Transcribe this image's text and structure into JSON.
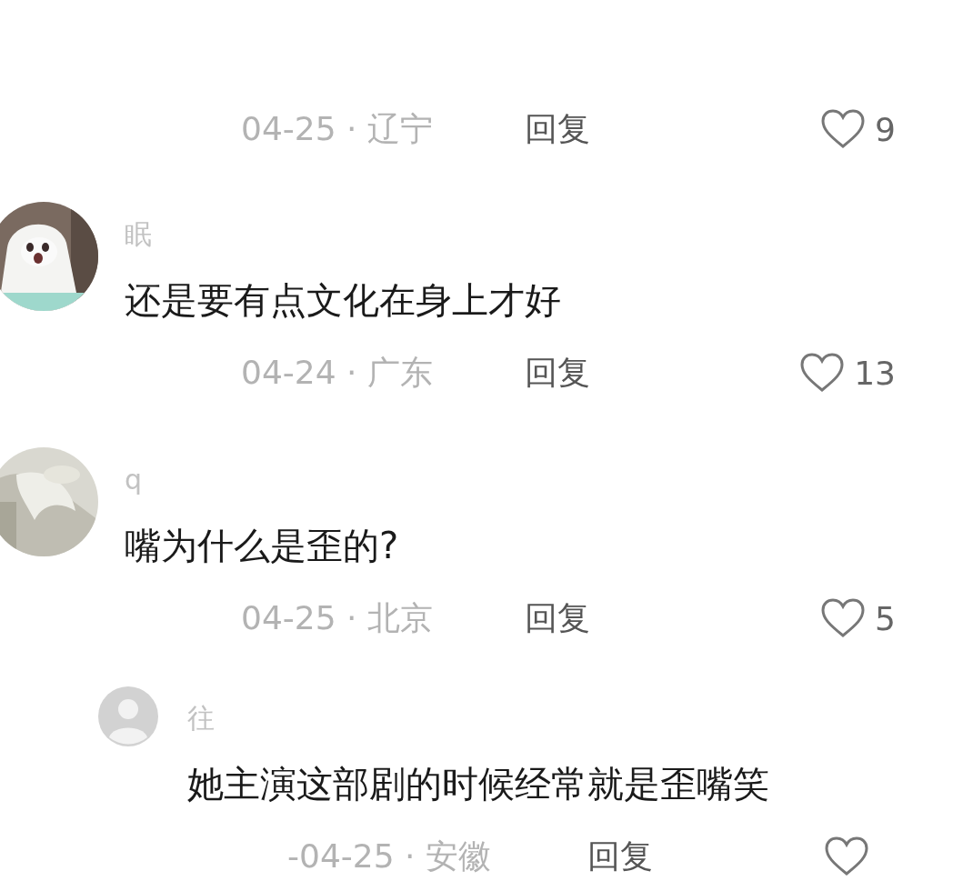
{
  "comments": [
    {
      "meta": "04-25 · 辽宁",
      "reply": "回复",
      "likes": "9"
    },
    {
      "name": "眠",
      "text": "还是要有点文化在身上才好",
      "meta": "04-24 · 广东",
      "reply": "回复",
      "likes": "13"
    },
    {
      "name": "q",
      "text": "嘴为什么是歪的?",
      "meta": "04-25 · 北京",
      "reply": "回复",
      "likes": "5",
      "children": [
        {
          "avatar": {
            "kind": "default"
          },
          "name": "往",
          "text": "她主演这部剧的时候经常就是歪嘴笑",
          "meta": "-04-25 · 安徽",
          "reply": "回复"
        }
      ]
    }
  ]
}
